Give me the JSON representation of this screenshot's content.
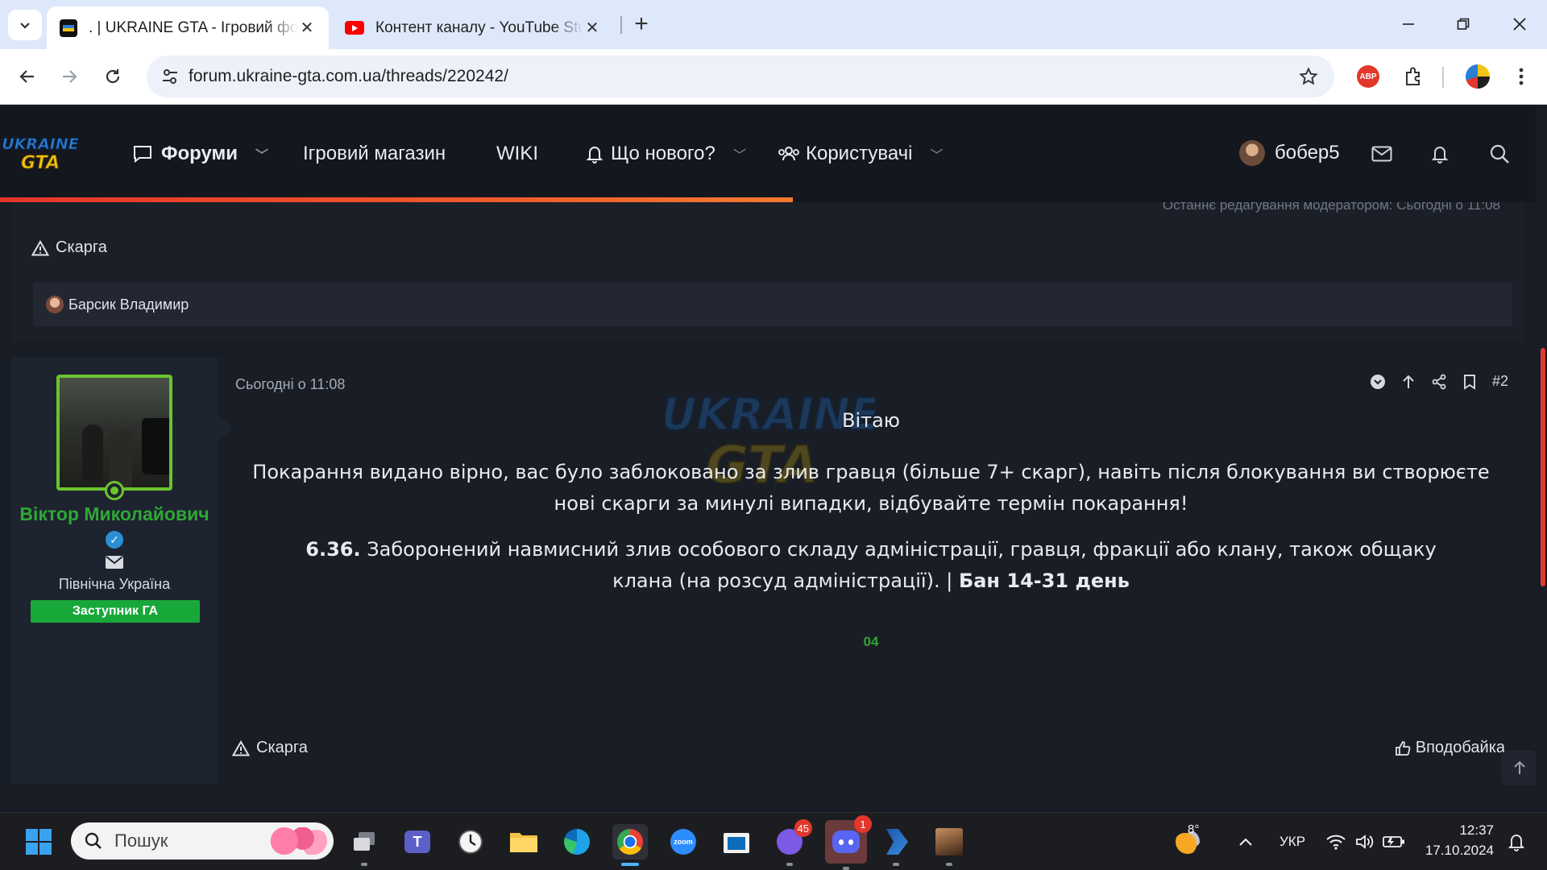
{
  "browser": {
    "tabs": [
      {
        "title": ". | UKRAINE GTA - Ігровий форум",
        "icon": "ukraine-gta-favicon",
        "active": true
      },
      {
        "title": "Контент каналу - YouTube Studio",
        "icon": "youtube-icon",
        "active": false
      }
    ],
    "url": "forum.ukraine-gta.com.ua/threads/220242/",
    "extensions": [
      "adblock-icon",
      "extensions-puzzle-icon",
      "profile-avatar"
    ]
  },
  "forum_nav": {
    "logo_text": "UKRAINE GTA",
    "items": [
      {
        "label": "Форуми",
        "icon": "chat-icon",
        "has_caret": true
      },
      {
        "label": "Ігровий магазин"
      },
      {
        "label": "WIKI"
      },
      {
        "label": "Що нового?",
        "icon": "bell-icon",
        "has_caret": true
      },
      {
        "label": "Користувачі",
        "icon": "users-icon",
        "has_caret": true
      }
    ],
    "username": "бобер5",
    "accent_color": "#f0592b"
  },
  "prev_post": {
    "edited_note": "Останнє редагування модератором: Сьогодні о 11:08",
    "report_label": "Скарга",
    "liked_by": "Барсик Владимир"
  },
  "post": {
    "author": {
      "name": "Віктор Миколайович",
      "region": "Північна Україна",
      "rank": "Заступник ГА",
      "name_color": "#2ea835"
    },
    "date": "Сьогодні о 11:08",
    "number": "#2",
    "greeting": "Вітаю",
    "paragraph": "Покарання видано вірно, вас було заблоковано за злив гравця (більше 7+ скарг), навіть після блокування ви створюєте нові скарги за минулі випадки, відбувайте термін покарання!",
    "rule_number": "6.36.",
    "rule_text": "Заборонений навмисний злив особового складу адміністрації, гравця, фракції або клану, також общаку клана (на розсуд адміністрації). |",
    "rule_penalty": "Бан 14-31 день",
    "signature": "04",
    "report_label": "Скарга",
    "like_label": "Вподобайка"
  },
  "taskbar": {
    "search_placeholder": "Пошук",
    "weather_temp": "8°",
    "language": "УКР",
    "time": "12:37",
    "date": "17.10.2024",
    "viber_badge": "45",
    "discord_badge": "1"
  }
}
